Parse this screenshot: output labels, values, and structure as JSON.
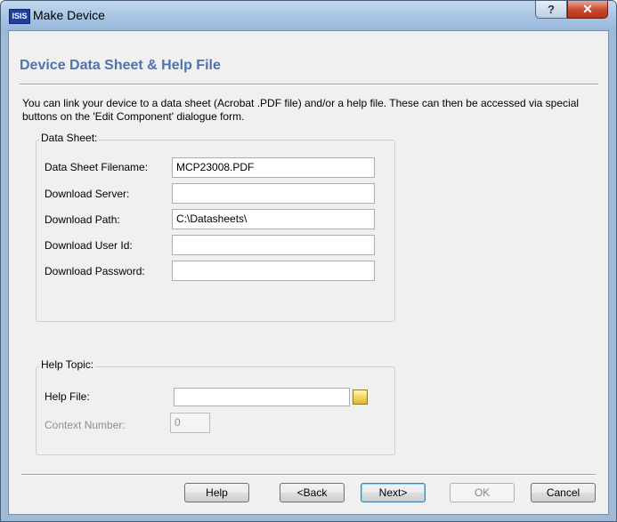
{
  "window": {
    "title": "Make Device",
    "app_icon_text": "ISIS",
    "help_button": "?",
    "close_button": "✕"
  },
  "page": {
    "title": "Device Data Sheet & Help File",
    "description": "You can link your device to a data sheet (Acrobat .PDF file) and/or a help file. These can then be accessed via special buttons on the 'Edit Component' dialogue form."
  },
  "data_sheet": {
    "group_title": "Data Sheet:",
    "filename": {
      "label": "Data Sheet Filename:",
      "mnemonic": "D",
      "value": "MCP23008.PDF"
    },
    "server": {
      "label": "Download Server:",
      "mnemonic": "S",
      "value": ""
    },
    "path": {
      "label": "Download Path:",
      "mnemonic": "D",
      "value": "C:\\Datasheets\\"
    },
    "user_id": {
      "label": "Download User Id:",
      "mnemonic": "U",
      "value": ""
    },
    "password": {
      "label": "Download Password:",
      "mnemonic": "P",
      "value": ""
    }
  },
  "help_topic": {
    "group_title": "Help Topic:",
    "help_file": {
      "label": "Help File:",
      "value": ""
    },
    "context_number": {
      "label": "Context Number:",
      "value": "0",
      "enabled": false
    }
  },
  "buttons": {
    "help": "Help",
    "back": "<Back",
    "next": "Next>",
    "ok": "OK",
    "cancel": "Cancel"
  },
  "colors": {
    "title_accent": "#4d74b0",
    "window_frame": "#9dbad8",
    "close_button": "#c8452d"
  }
}
